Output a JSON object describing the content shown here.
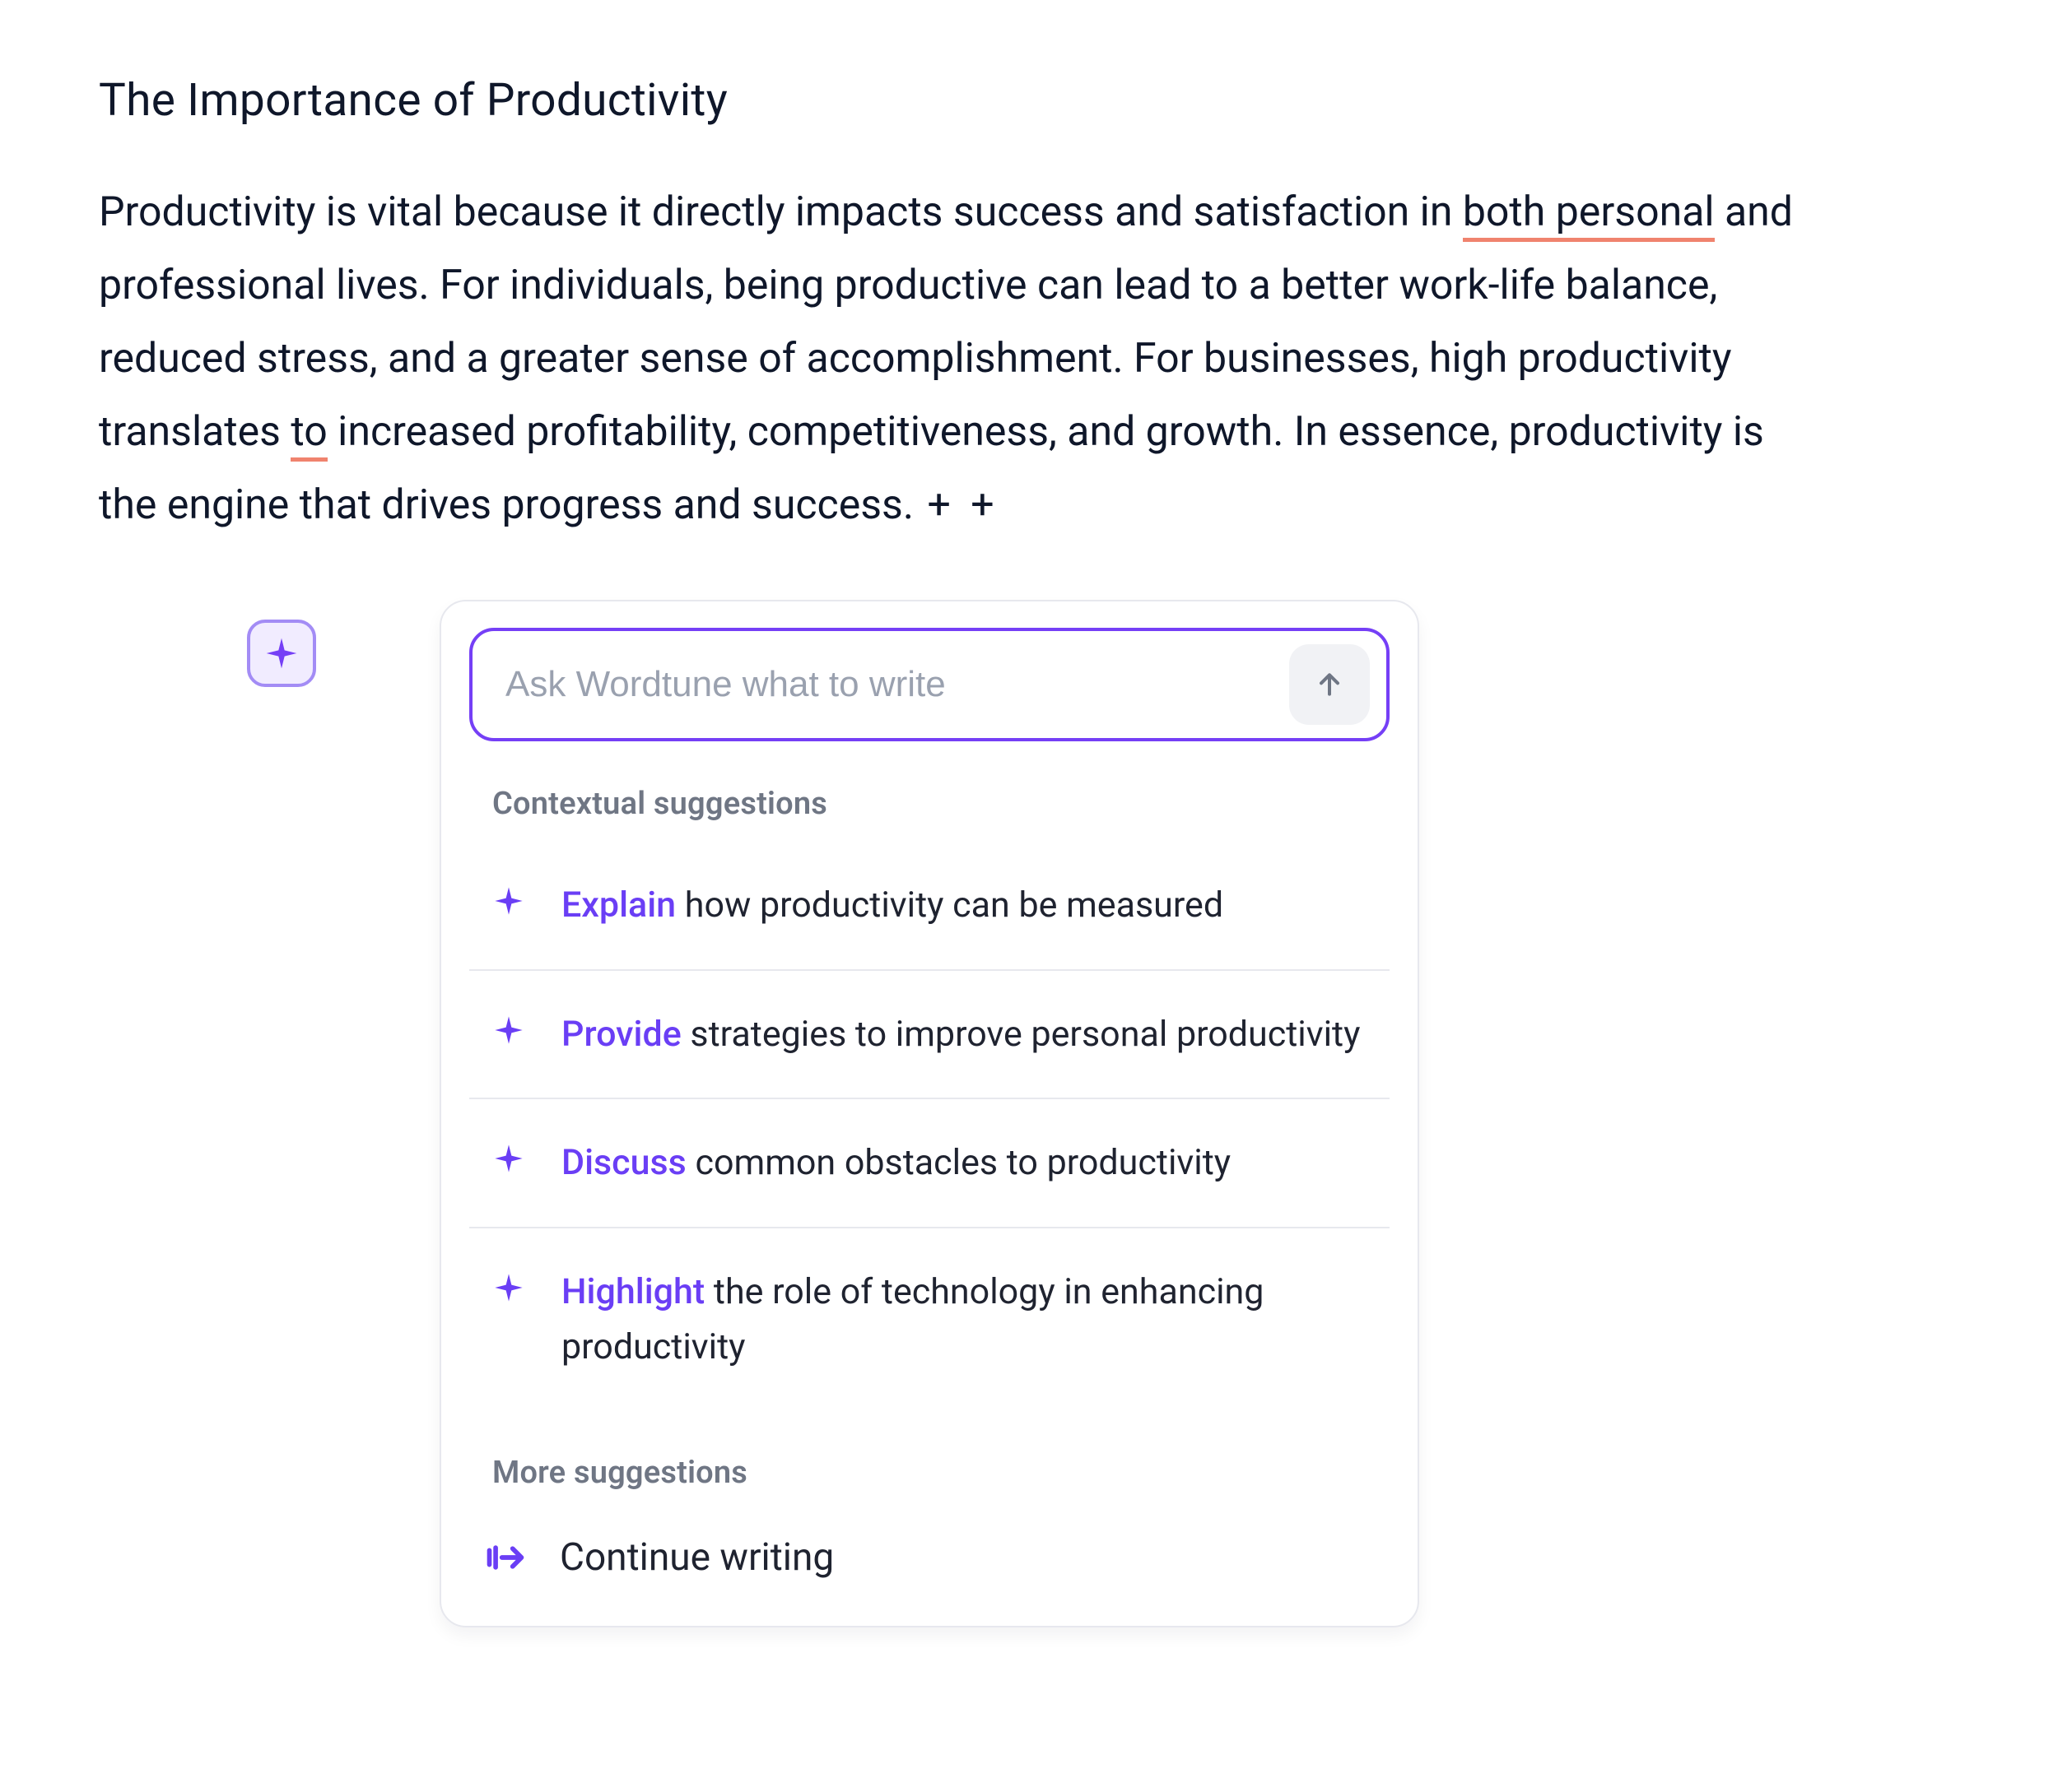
{
  "doc": {
    "title": "The Importance of Productivity",
    "paragraph_plain_before_first_mark": "Productivity is vital because it directly impacts success and satisfaction in ",
    "mark1": "both personal",
    "after_mark1": " and professional lives. For individuals, being productive can lead to a better work-life balance, reduced stress, and a greater sense of accomplishment. For businesses, high productivity translates ",
    "mark2": "to",
    "after_mark2": " increased profitability, competitiveness, and growth. In essence, productivity is the engine that drives progress and success. ",
    "plus_markers": "+ +"
  },
  "panel": {
    "ask_placeholder": "Ask Wordtune what to write",
    "contextual_label": "Contextual suggestions",
    "more_label": "More suggestions",
    "suggestions": [
      {
        "verb": "Explain",
        "rest": " how productivity can be measured"
      },
      {
        "verb": "Provide",
        "rest": " strategies to improve personal productivity"
      },
      {
        "verb": "Discuss",
        "rest": " common obstacles to productivity"
      },
      {
        "verb": "Highlight",
        "rest": " the role of technology in enhancing productivity"
      }
    ],
    "more": [
      {
        "label": "Continue writing"
      }
    ]
  },
  "colors": {
    "accent": "#753ff6",
    "accent_light": "#a38cf5",
    "error_underline": "#f0836e"
  }
}
